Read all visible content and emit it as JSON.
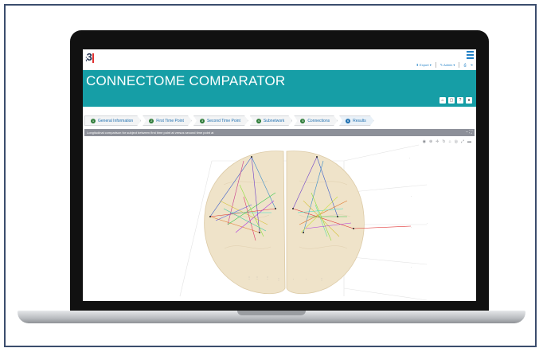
{
  "app": {
    "title": "CONNECTOME COMPARATOR",
    "logo_text": "3",
    "menu": {
      "export": "Export",
      "admin": "Admin"
    }
  },
  "icons": {
    "menu": "hamburger-icon",
    "export": "export-icon",
    "admin": "wrench-icon",
    "print": "print-icon",
    "logout": "logout-icon",
    "header": [
      "home-icon",
      "window-icon",
      "help-icon",
      "user-icon"
    ],
    "plot_toolbar": [
      "camera-icon",
      "zoom-icon",
      "pan-icon",
      "rotate-icon",
      "home-icon",
      "orbit-icon",
      "autoscale-icon",
      "plotly-logo-icon"
    ]
  },
  "steps": [
    {
      "num": "1",
      "label": "General Information"
    },
    {
      "num": "2",
      "label": "First Time Point"
    },
    {
      "num": "3",
      "label": "Second Time Point"
    },
    {
      "num": "4",
      "label": "Subnetwork"
    },
    {
      "num": "5",
      "label": "Connections"
    },
    {
      "num": "6",
      "label": "Results"
    }
  ],
  "panel": {
    "title": "Longitudinal comparison for subject between first time point at versus second time point at",
    "minimize": "−",
    "maximize": "⛶"
  },
  "colors": {
    "header": "#169ea6",
    "step_done": "#2f7d3a",
    "step_active": "#1e6fb0",
    "frame": "#3b4d6d"
  }
}
